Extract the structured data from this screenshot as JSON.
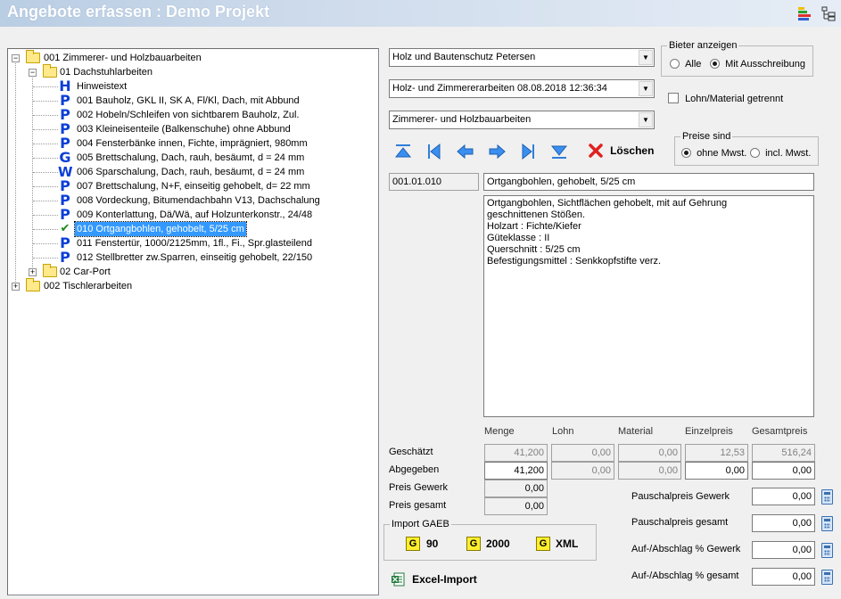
{
  "window": {
    "title": "Angebote erfassen : Demo Projekt"
  },
  "toolbar_icons": [
    "chart-icon",
    "tree-view-icon"
  ],
  "tree": {
    "nodes": [
      {
        "label": "001 Zimmerer- und Holzbauarbeiten",
        "icon": "folder",
        "expander": "-"
      },
      {
        "label": "01 Dachstuhlarbeiten",
        "icon": "folder",
        "expander": "-"
      },
      {
        "label": "Hinweistext",
        "icon": "H"
      },
      {
        "label": "001 Bauholz, GKL II, SK A, Fl/Kl, Dach, mit Abbund",
        "icon": "P"
      },
      {
        "label": "002 Hobeln/Schleifen von sichtbarem Bauholz, Zul.",
        "icon": "P"
      },
      {
        "label": "003 Kleineisenteile (Balkenschuhe) ohne Abbund",
        "icon": "P"
      },
      {
        "label": "004 Fensterbänke innen, Fichte, imprägniert, 980mm",
        "icon": "P"
      },
      {
        "label": "005 Brettschalung, Dach, rauh, besäumt, d = 24 mm",
        "icon": "G"
      },
      {
        "label": "006 Sparschalung, Dach, rauh, besäumt, d = 24 mm",
        "icon": "W"
      },
      {
        "label": "007 Brettschalung, N+F, einseitig gehobelt, d= 22 mm",
        "icon": "P"
      },
      {
        "label": "008 Vordeckung, Bitumendachbahn V13, Dachschalung",
        "icon": "P"
      },
      {
        "label": "009 Konterlattung, Dä/Wä, auf Holzunterkonstr., 24/48",
        "icon": "P"
      },
      {
        "label": "010 Ortgangbohlen, gehobelt, 5/25 cm",
        "icon": "check",
        "selected": true
      },
      {
        "label": "011 Fenstertür, 1000/2125mm, 1fl., Fi., Spr.glasteilend",
        "icon": "P"
      },
      {
        "label": "012 Stellbretter zw.Sparren, einseitig gehobelt, 22/150",
        "icon": "P"
      },
      {
        "label": "02 Car-Port",
        "icon": "folder",
        "expander": "+"
      },
      {
        "label": "002 Tischlerarbeiten",
        "icon": "folder",
        "expander": "+"
      }
    ]
  },
  "combos": {
    "bieter": "Holz und Bautenschutz Petersen",
    "angebot": "Holz- und Zimmererarbeiten 08.08.2018 12:36:34",
    "gewerk": "Zimmerer- und Holzbauarbeiten"
  },
  "bieter_anzeigen": {
    "legend": "Bieter anzeigen",
    "option_alle": "Alle",
    "option_mit": "Mit Ausschreibung",
    "selected": "Mit Ausschreibung"
  },
  "lohn_material_label": "Lohn/Material getrennt",
  "preise_sind": {
    "legend": "Preise sind",
    "option_ohne": "ohne Mwst.",
    "option_incl": "incl. Mwst.",
    "selected": "ohne Mwst."
  },
  "nav_icons": [
    "first-icon",
    "prev-group-icon",
    "prev-icon",
    "next-icon",
    "next-group-icon",
    "last-icon"
  ],
  "delete_label": "Löschen",
  "position": {
    "number": "001.01.010",
    "short_text": "Ortgangbohlen, gehobelt, 5/25 cm",
    "long_text": "Ortgangbohlen, Sichtflächen gehobelt, mit auf Gehrung\ngeschnittenen Stößen.\nHolzart : Fichte/Kiefer\nGüteklasse : II\nQuerschnitt : 5/25 cm\nBefestigungsmittel : Senkkopfstifte verz."
  },
  "grid": {
    "columns": [
      "Menge",
      "Lohn",
      "Material",
      "Einzelpreis",
      "Gesamtpreis"
    ],
    "geschaetzt_label": "Geschätzt",
    "geschaetzt": [
      "41,200",
      "0,00",
      "0,00",
      "12,53",
      "516,24"
    ],
    "abgegeben_label": "Abgegeben",
    "abgegeben": [
      "41,200",
      "0,00",
      "0,00",
      "0,00",
      "0,00"
    ],
    "preis_gewerk_label": "Preis Gewerk",
    "preis_gewerk": "0,00",
    "preis_gesamt_label": "Preis gesamt",
    "preis_gesamt": "0,00"
  },
  "pauschal": {
    "gewerk_label": "Pauschalpreis Gewerk",
    "gewerk": "0,00",
    "gesamt_label": "Pauschalpreis gesamt",
    "gesamt": "0,00",
    "auf_gewerk_label": "Auf-/Abschlag % Gewerk",
    "auf_gewerk": "0,00",
    "auf_gesamt_label": "Auf-/Abschlag % gesamt",
    "auf_gesamt": "0,00"
  },
  "import_gaeb": {
    "legend": "Import GAEB",
    "btn90": "90",
    "btn2000": "2000",
    "btnxml": "XML",
    "g_letter": "G"
  },
  "excel_import_label": "Excel-Import"
}
